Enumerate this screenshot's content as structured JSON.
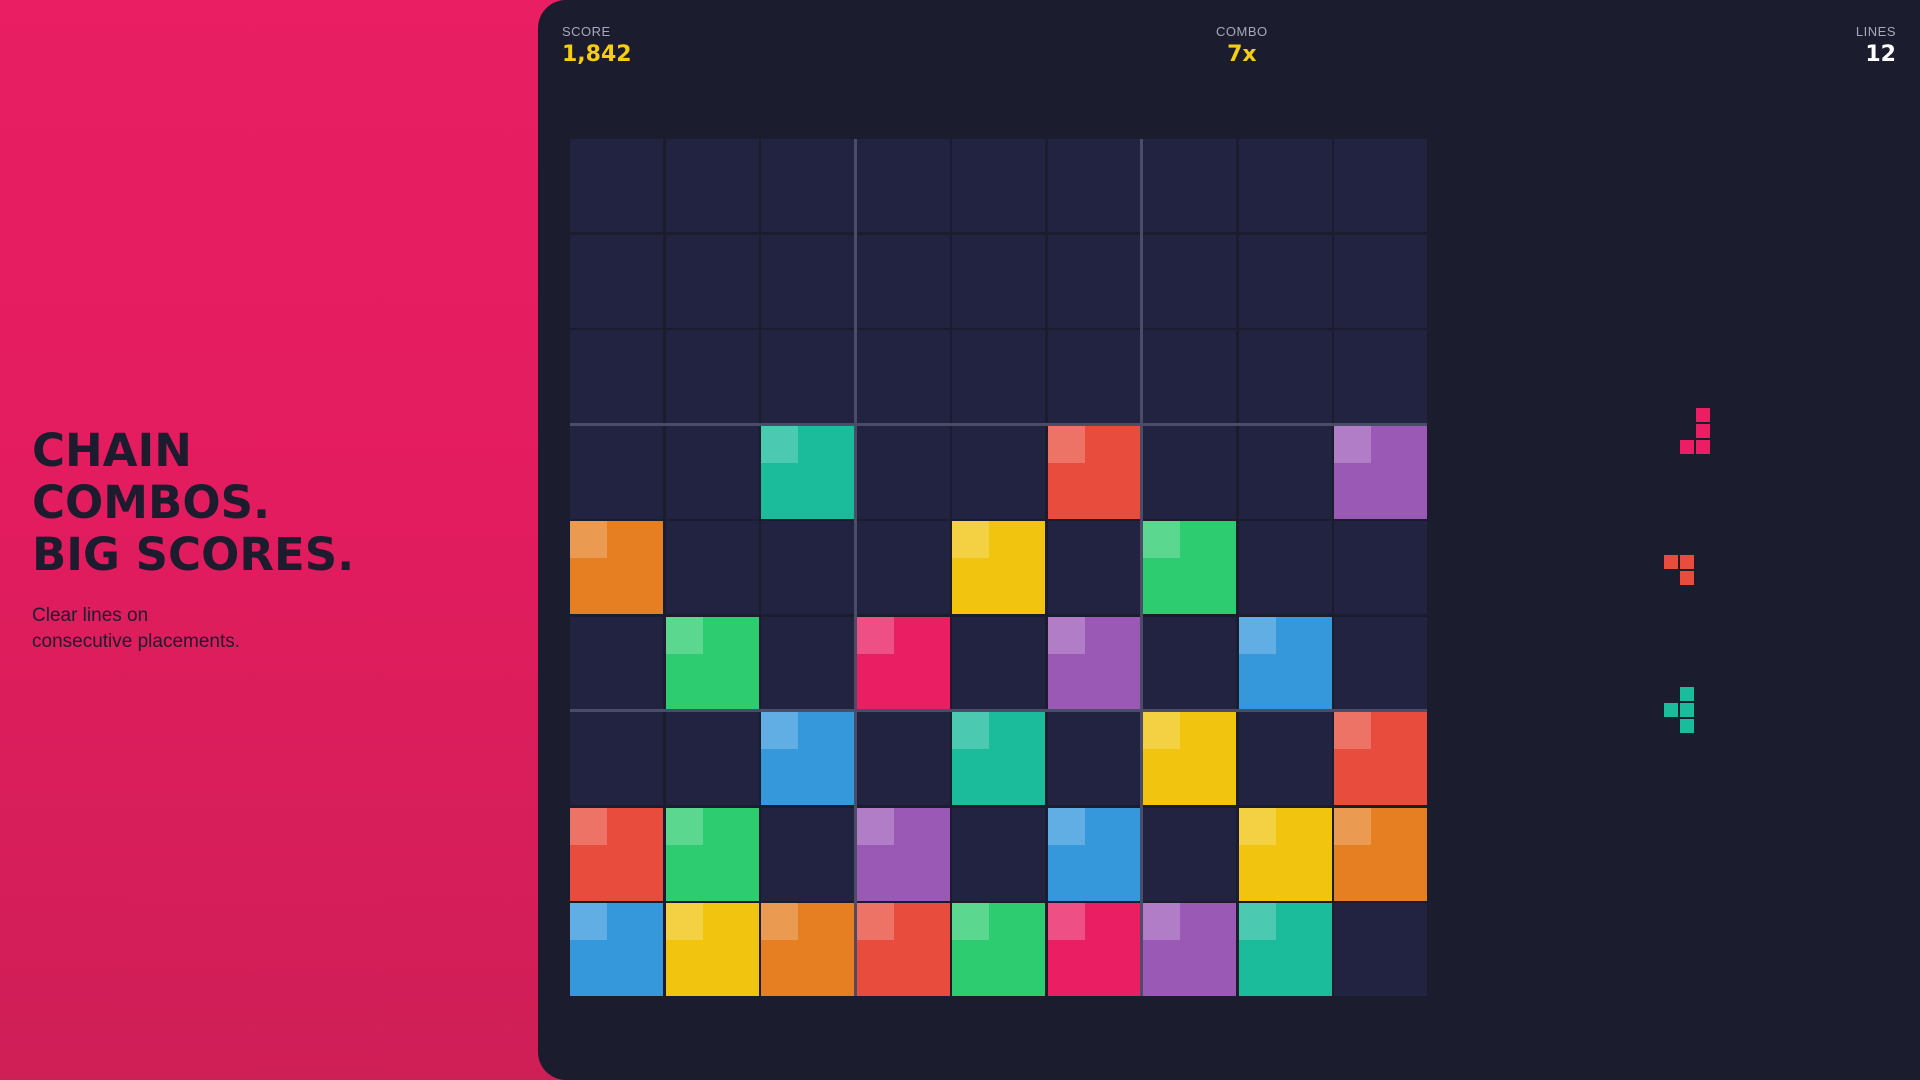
{
  "promo": {
    "headline": [
      "CHAIN",
      "COMBOS.",
      "BIG SCORES."
    ],
    "subtext": [
      "Clear lines on",
      "consecutive placements."
    ]
  },
  "hud": {
    "score_label": "SCORE",
    "score_value": "1,842",
    "combo_label": "COMBO",
    "combo_value": "7x",
    "lines_label": "LINES",
    "lines_value": "12"
  },
  "colors": {
    "teal": "#1abc9c",
    "red": "#e74c3c",
    "purple": "#9b59b6",
    "orange": "#e67e22",
    "yellow": "#f1c40f",
    "green": "#2ecc71",
    "pink": "#e91e63",
    "blue": "#3498db",
    "empty": "#222340",
    "panel": "#1b1c2e"
  },
  "board": {
    "size": 9,
    "cells": [
      [
        null,
        null,
        null,
        null,
        null,
        null,
        null,
        null,
        null
      ],
      [
        null,
        null,
        null,
        null,
        null,
        null,
        null,
        null,
        null
      ],
      [
        null,
        null,
        null,
        null,
        null,
        null,
        null,
        null,
        null
      ],
      [
        null,
        null,
        "teal",
        null,
        null,
        "red",
        null,
        null,
        "purple"
      ],
      [
        "orange",
        null,
        null,
        null,
        "yellow",
        null,
        "green",
        null,
        null
      ],
      [
        null,
        "green",
        null,
        "pink",
        null,
        "purple",
        null,
        "blue",
        null
      ],
      [
        null,
        null,
        "blue",
        null,
        "teal",
        null,
        "yellow",
        null,
        "red"
      ],
      [
        "red",
        "green",
        null,
        "purple",
        null,
        "blue",
        null,
        "yellow",
        "orange"
      ],
      [
        "blue",
        "yellow",
        "orange",
        "red",
        "green",
        "pink",
        "purple",
        "teal",
        null
      ]
    ]
  },
  "tray": {
    "pieces": [
      {
        "color": "pink",
        "shape": [
          [
            0,
            0,
            1
          ],
          [
            0,
            0,
            1
          ],
          [
            0,
            1,
            1
          ]
        ]
      },
      {
        "color": "red",
        "shape": [
          [
            1,
            1
          ],
          [
            0,
            1
          ]
        ]
      },
      {
        "color": "teal",
        "shape": [
          [
            0,
            1
          ],
          [
            1,
            1
          ],
          [
            0,
            1
          ]
        ]
      }
    ]
  }
}
